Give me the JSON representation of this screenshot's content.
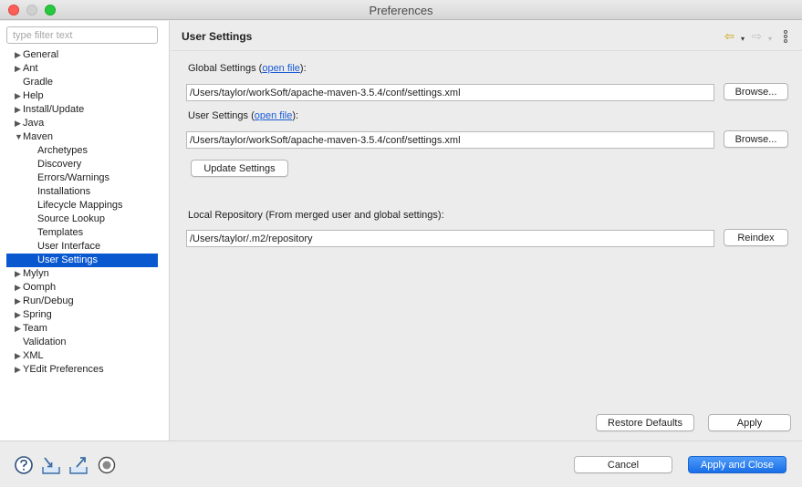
{
  "window": {
    "title": "Preferences"
  },
  "filter": {
    "placeholder": "type filter text"
  },
  "tree": [
    {
      "label": "General",
      "level": 0,
      "twisty": "collapsed"
    },
    {
      "label": "Ant",
      "level": 0,
      "twisty": "collapsed"
    },
    {
      "label": "Gradle",
      "level": 0,
      "twisty": "none"
    },
    {
      "label": "Help",
      "level": 0,
      "twisty": "collapsed"
    },
    {
      "label": "Install/Update",
      "level": 0,
      "twisty": "collapsed"
    },
    {
      "label": "Java",
      "level": 0,
      "twisty": "collapsed"
    },
    {
      "label": "Maven",
      "level": 0,
      "twisty": "expanded"
    },
    {
      "label": "Archetypes",
      "level": 1,
      "twisty": "none"
    },
    {
      "label": "Discovery",
      "level": 1,
      "twisty": "none"
    },
    {
      "label": "Errors/Warnings",
      "level": 1,
      "twisty": "none"
    },
    {
      "label": "Installations",
      "level": 1,
      "twisty": "none"
    },
    {
      "label": "Lifecycle Mappings",
      "level": 1,
      "twisty": "none"
    },
    {
      "label": "Source Lookup",
      "level": 1,
      "twisty": "none"
    },
    {
      "label": "Templates",
      "level": 1,
      "twisty": "none"
    },
    {
      "label": "User Interface",
      "level": 1,
      "twisty": "none"
    },
    {
      "label": "User Settings",
      "level": 1,
      "twisty": "none",
      "selected": true
    },
    {
      "label": "Mylyn",
      "level": 0,
      "twisty": "collapsed"
    },
    {
      "label": "Oomph",
      "level": 0,
      "twisty": "collapsed"
    },
    {
      "label": "Run/Debug",
      "level": 0,
      "twisty": "collapsed"
    },
    {
      "label": "Spring",
      "level": 0,
      "twisty": "collapsed"
    },
    {
      "label": "Team",
      "level": 0,
      "twisty": "collapsed"
    },
    {
      "label": "Validation",
      "level": 0,
      "twisty": "none"
    },
    {
      "label": "XML",
      "level": 0,
      "twisty": "collapsed"
    },
    {
      "label": "YEdit Preferences",
      "level": 0,
      "twisty": "collapsed"
    }
  ],
  "page": {
    "title": "User Settings",
    "global_label_prefix": "Global Settings (",
    "global_link": "open file",
    "global_label_suffix": "):",
    "global_path": "/Users/taylor/workSoft/apache-maven-3.5.4/conf/settings.xml",
    "user_label_prefix": "User Settings (",
    "user_link": "open file",
    "user_label_suffix": "):",
    "user_path": "/Users/taylor/workSoft/apache-maven-3.5.4/conf/settings.xml",
    "browse_label": "Browse...",
    "update_label": "Update Settings",
    "local_repo_label": "Local Repository (From merged user and global settings):",
    "local_repo_path": "/Users/taylor/.m2/repository",
    "reindex_label": "Reindex",
    "restore_label": "Restore Defaults",
    "apply_label": "Apply"
  },
  "footer": {
    "cancel_label": "Cancel",
    "apply_close_label": "Apply and Close"
  },
  "icons": {
    "help": "help-icon",
    "import": "import-icon",
    "export": "export-icon",
    "record": "record-icon",
    "back": "back-arrow-icon",
    "forward": "forward-arrow-icon",
    "more": "more-icon"
  },
  "colors": {
    "selection": "#0a58d0",
    "link": "#1a5bd6",
    "primary_button": "#1a6fe8"
  }
}
